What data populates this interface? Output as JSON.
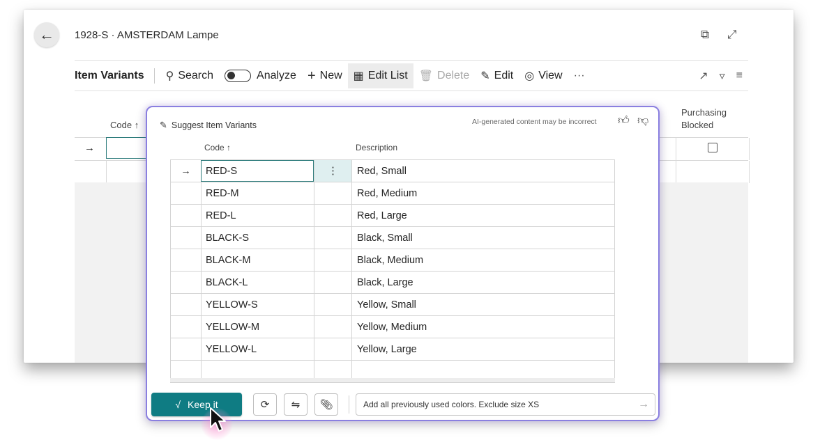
{
  "window": {
    "title": "1928-S · AMSTERDAM Lampe"
  },
  "toolbar": {
    "section_title": "Item Variants",
    "search_label": "Search",
    "analyze_label": "Analyze",
    "new_label": "New",
    "edit_list_label": "Edit List",
    "delete_label": "Delete",
    "edit_label": "Edit",
    "view_label": "View",
    "more_label": "···"
  },
  "grid": {
    "columns": {
      "code": "Code ↑",
      "purchasing_blocked_line1": "Purchasing",
      "purchasing_blocked_line2": "Blocked"
    },
    "row_arrow": "→"
  },
  "copilot": {
    "title": "Suggest Item Variants",
    "disclaimer": "AI-generated content may be incorrect",
    "columns": {
      "code": "Code ↑",
      "description": "Description"
    },
    "rows": [
      {
        "code": "RED-S",
        "description": "Red, Small"
      },
      {
        "code": "RED-M",
        "description": "Red, Medium"
      },
      {
        "code": "RED-L",
        "description": "Red, Large"
      },
      {
        "code": "BLACK-S",
        "description": "Black, Small"
      },
      {
        "code": "BLACK-M",
        "description": "Black, Medium"
      },
      {
        "code": "BLACK-L",
        "description": "Black, Large"
      },
      {
        "code": "YELLOW-S",
        "description": "Yellow, Small"
      },
      {
        "code": "YELLOW-M",
        "description": "Yellow, Medium"
      },
      {
        "code": "YELLOW-L",
        "description": "Yellow, Large"
      }
    ],
    "selected_row_arrow": "→",
    "row_menu": "⋮",
    "keep_label": "Keep it",
    "prompt_text": "Add all previously used colors. Exclude size XS",
    "accent_color": "#0f7c83"
  }
}
